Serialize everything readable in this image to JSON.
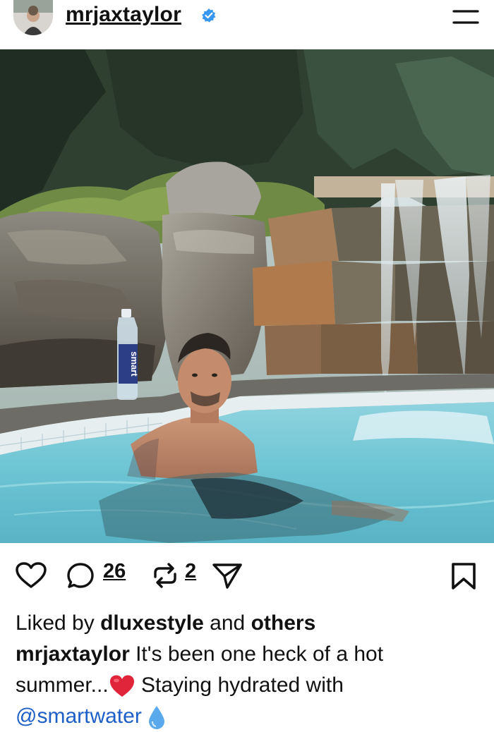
{
  "post": {
    "username": "mrjaxtaylor",
    "verified": true,
    "comments_count": "26",
    "reposts_count": "2",
    "liked_by_prefix": "Liked by",
    "liked_by_user": "dluxestyle",
    "liked_by_and": "and",
    "liked_by_others": "others",
    "caption_user": "mrjaxtaylor",
    "caption_line1": "It's been one heck of a hot",
    "caption_line2a": "summer...",
    "caption_line2b": "Staying hydrated with",
    "caption_mention": "@smartwater",
    "bottle_label": "smart"
  },
  "colors": {
    "verified_badge": "#3897f0",
    "mention": "#1d5fc7",
    "heart_emoji": "#e0243a",
    "droplet_emoji": "#5aa9ec"
  },
  "icons": [
    "heart-icon",
    "comment-icon",
    "repost-icon",
    "share-icon",
    "bookmark-icon",
    "menu-icon",
    "verified-badge-icon"
  ]
}
